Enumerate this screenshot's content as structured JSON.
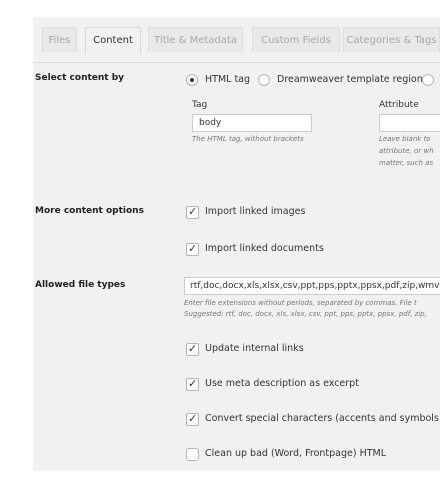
{
  "tabs": [
    {
      "label": "Files",
      "active": false
    },
    {
      "label": "Content",
      "active": true
    },
    {
      "label": "Title & Metadata",
      "active": false
    },
    {
      "label": "Custom Fields",
      "active": false
    },
    {
      "label": "Categories & Tags",
      "active": false
    }
  ],
  "select_content": {
    "label": "Select content by",
    "options": [
      "HTML tag",
      "Dreamweaver template region"
    ],
    "selected": "HTML tag",
    "tag_label": "Tag",
    "tag_value": "body",
    "tag_help": "The HTML tag, without brackets",
    "attribute_label": "Attribute",
    "attribute_value": "",
    "attribute_help": [
      "Leave blank to",
      "attribute, or wh",
      "matter, such as"
    ]
  },
  "more_content": {
    "label": "More content options",
    "import_images": "Import linked images",
    "import_documents": "Import linked documents"
  },
  "file_types": {
    "label": "Allowed file types",
    "value": "rtf,doc,docx,xls,xlsx,csv,ppt,pps,pptx,ppsx,pdf,zip,wmv,a",
    "help1": "Enter file extensions without periods, separated by commas. File t",
    "help2": "Suggested: rtf, doc, docx, xls, xlsx, csv, ppt, pps, pptx, ppsx, pdf, zip,"
  },
  "options": {
    "update_links": "Update internal links",
    "meta_excerpt": "Use meta description as excerpt",
    "convert_special": "Convert special characters (accents and symbols)",
    "clean_html": "Clean up bad (Word, Frontpage) HTML"
  }
}
